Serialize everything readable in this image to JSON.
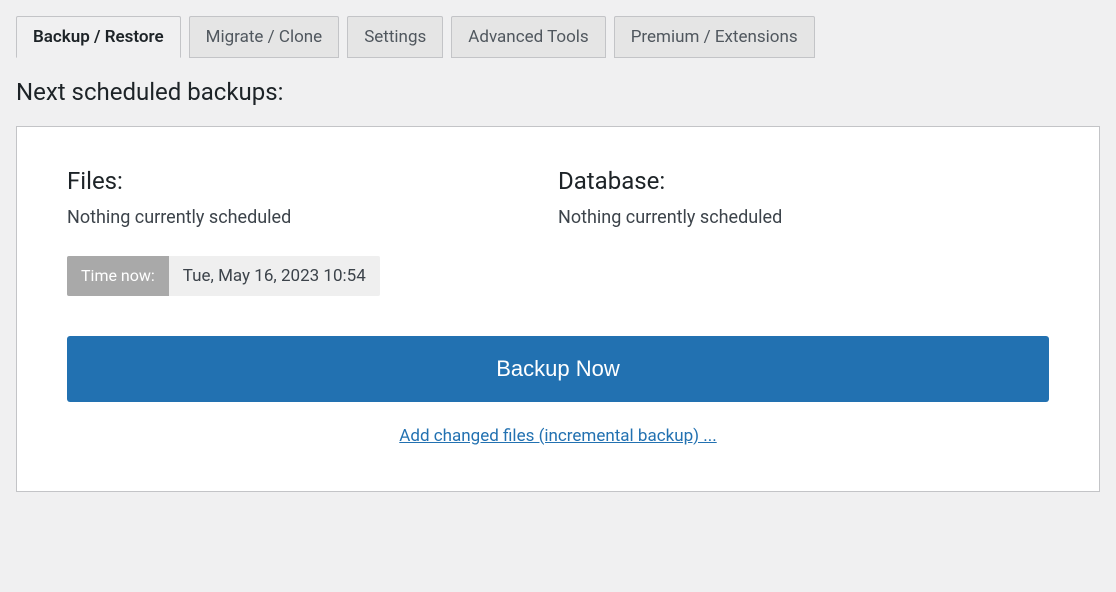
{
  "tabs": {
    "backup_restore": "Backup / Restore",
    "migrate_clone": "Migrate / Clone",
    "settings": "Settings",
    "advanced_tools": "Advanced Tools",
    "premium_extensions": "Premium / Extensions"
  },
  "heading": "Next scheduled backups:",
  "files": {
    "title": "Files:",
    "status": "Nothing currently scheduled"
  },
  "database": {
    "title": "Database:",
    "status": "Nothing currently scheduled"
  },
  "time": {
    "label": "Time now:",
    "value": "Tue, May 16, 2023 10:54"
  },
  "backup_button": "Backup Now",
  "incremental_link": "Add changed files (incremental backup) ..."
}
